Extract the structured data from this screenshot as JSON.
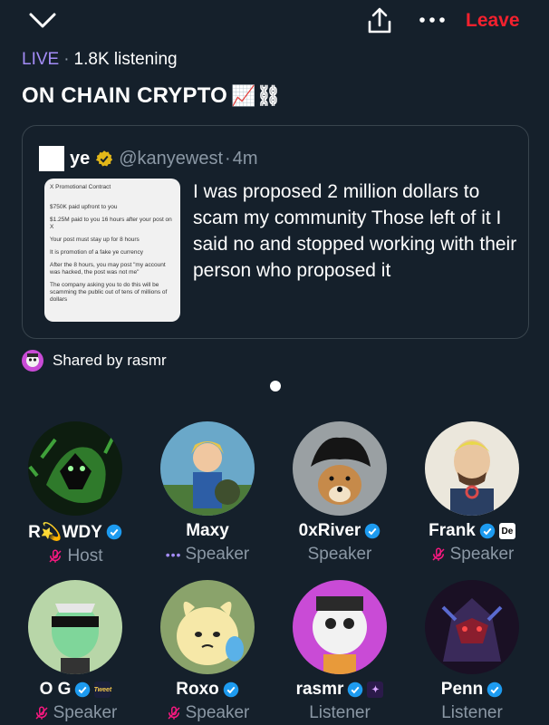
{
  "header": {
    "leave_label": "Leave"
  },
  "space": {
    "live_label": "LIVE",
    "listening": "1.8K listening",
    "title": "ON CHAIN CRYPTO",
    "title_emoji": "📈⛓"
  },
  "tweet": {
    "display_name": "ye",
    "handle": "@kanyewest",
    "time": "4m",
    "text": "I was proposed 2 million dollars to scam my community    Those left of it    I said no and stopped working with their person who proposed it",
    "image_lines": [
      "X Promotional Contract",
      "$750K paid upfront to you",
      "$1.25M paid to you 16 hours after your post on X",
      "Your post must stay up for 8 hours",
      "It is promotion of a fake ye currency",
      "After the 8 hours, you may post \"my account was hacked, the post was not me\"",
      "The company asking you to do this will be scamming the public out of tens of millions of dollars"
    ]
  },
  "shared_by": "Shared by rasmr",
  "participants": [
    {
      "name": "R💫WDY",
      "role": "Host",
      "verified": true,
      "muted": true
    },
    {
      "name": "Maxy",
      "role": "Speaker",
      "verified": false,
      "speaking": true
    },
    {
      "name": "0xRiver",
      "role": "Speaker",
      "verified": true
    },
    {
      "name": "Frank",
      "role": "Speaker",
      "verified": true,
      "muted": true,
      "extra_badge": "De"
    },
    {
      "name": "O G",
      "role": "Speaker",
      "verified": true,
      "muted": true,
      "extra_badge": "Tweet"
    },
    {
      "name": "Roxo",
      "role": "Speaker",
      "verified": true,
      "muted": true
    },
    {
      "name": "rasmr",
      "role": "Listener",
      "verified": true,
      "extra_badge": "✦"
    },
    {
      "name": "Penn",
      "role": "Listener",
      "verified": true
    }
  ],
  "colors": {
    "background": "#15202b",
    "accent_purple": "#a48cf7",
    "leave_red": "#f4212e",
    "verified_blue": "#1d9bf0",
    "muted_pink": "#f91880",
    "gray_text": "#8b98a5"
  }
}
